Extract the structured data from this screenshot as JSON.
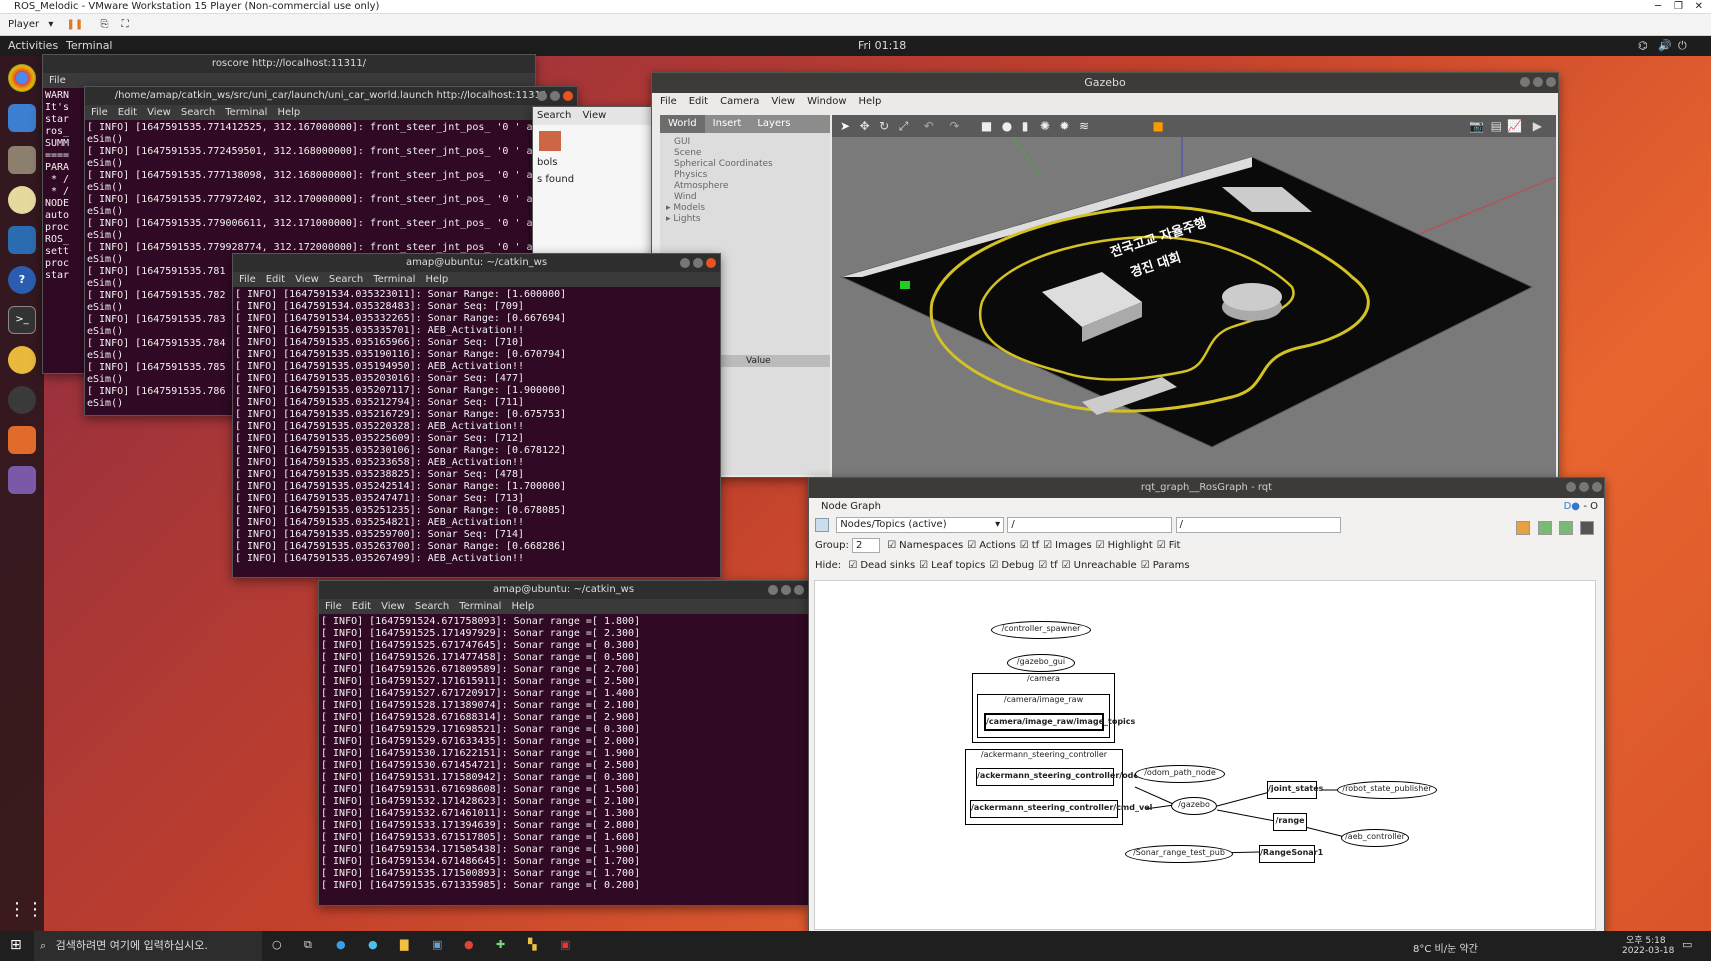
{
  "vm": {
    "title": "ROS_Melodic - VMware Workstation 15 Player (Non-commercial use only)",
    "player_label": "Player"
  },
  "topbar": {
    "activities": "Activities",
    "app_menu": "Terminal",
    "clock": "Fri 01:18"
  },
  "term_roscore": {
    "title": "roscore http://localhost:11311/",
    "menu_file": "File",
    "lines": [
      "WARN",
      "It's",
      "",
      "star",
      "ros_",
      "",
      "",
      "SUMM",
      "====",
      "",
      "PARA",
      " * /",
      " * /",
      "",
      "NODE",
      "",
      "auto",
      "proc",
      "ROS_",
      "",
      "sett",
      "proc",
      "star"
    ]
  },
  "term_launch": {
    "title": "/home/amap/catkin_ws/src/uni_car/launch/uni_car_world.launch http://localhost:11311",
    "menu": [
      "File",
      "Edit",
      "View",
      "Search",
      "Terminal",
      "Help"
    ],
    "lines": [
      "[ INFO] [1647591535.771412525, 312.167000000]: front_steer_jnt_pos_ '0 ' at writ",
      "eSim()",
      "[ INFO] [1647591535.772459501, 312.168000000]: front_steer_jnt_pos_ '0 ' at writ",
      "eSim()",
      "[ INFO] [1647591535.777138098, 312.168000000]: front_steer_jnt_pos_ '0 ' at writ",
      "eSim()",
      "[ INFO] [1647591535.777972402, 312.170000000]: front_steer_jnt_pos_ '0 ' at writ",
      "eSim()",
      "[ INFO] [1647591535.779006611, 312.171000000]: front_steer_jnt_pos_ '0 ' at writ",
      "eSim()",
      "[ INFO] [1647591535.779928774, 312.172000000]: front_steer_jnt_pos_ '0 ' at writ",
      "eSim()",
      "[ INFO] [1647591535.781",
      "eSim()",
      "[ INFO] [1647591535.782",
      "eSim()",
      "[ INFO] [1647591535.783",
      "eSim()",
      "[ INFO] [1647591535.784",
      "eSim()",
      "[ INFO] [1647591535.785",
      "eSim()",
      "[ INFO] [1647591535.786",
      "eSim()"
    ]
  },
  "term_sonar": {
    "title": "amap@ubuntu: ~/catkin_ws",
    "menu": [
      "File",
      "Edit",
      "View",
      "Search",
      "Terminal",
      "Help"
    ],
    "lines": [
      "[ INFO] [1647591534.035323011]: Sonar Range: [1.600000]",
      "[ INFO] [1647591534.035328483]: Sonar Seq: [709]",
      "[ INFO] [1647591534.035332265]: Sonar Range: [0.667694]",
      "[ INFO] [1647591535.035335701]: AEB_Activation!!",
      "[ INFO] [1647591535.035165966]: Sonar Seq: [710]",
      "[ INFO] [1647591535.035190116]: Sonar Range: [0.670794]",
      "[ INFO] [1647591535.035194950]: AEB_Activation!!",
      "[ INFO] [1647591535.035203016]: Sonar Seq: [477]",
      "[ INFO] [1647591535.035207117]: Sonar Range: [1.900000]",
      "[ INFO] [1647591535.035212794]: Sonar Seq: [711]",
      "[ INFO] [1647591535.035216729]: Sonar Range: [0.675753]",
      "[ INFO] [1647591535.035220328]: AEB_Activation!!",
      "[ INFO] [1647591535.035225609]: Sonar Seq: [712]",
      "[ INFO] [1647591535.035230106]: Sonar Range: [0.678122]",
      "[ INFO] [1647591535.035233658]: AEB_Activation!!",
      "[ INFO] [1647591535.035238825]: Sonar Seq: [478]",
      "[ INFO] [1647591535.035242514]: Sonar Range: [1.700000]",
      "[ INFO] [1647591535.035247471]: Sonar Seq: [713]",
      "[ INFO] [1647591535.035251235]: Sonar Range: [0.678085]",
      "[ INFO] [1647591535.035254821]: AEB_Activation!!",
      "[ INFO] [1647591535.035259700]: Sonar Seq: [714]",
      "[ INFO] [1647591535.035263700]: Sonar Range: [0.668286]",
      "[ INFO] [1647591535.035267499]: AEB_Activation!!"
    ]
  },
  "term_range": {
    "title": "amap@ubuntu: ~/catkin_ws",
    "menu": [
      "File",
      "Edit",
      "View",
      "Search",
      "Terminal",
      "Help"
    ],
    "lines": [
      "[ INFO] [1647591524.671758093]: Sonar range =[ 1.800]",
      "[ INFO] [1647591525.171497929]: Sonar range =[ 2.300]",
      "[ INFO] [1647591525.671747645]: Sonar range =[ 0.300]",
      "[ INFO] [1647591526.171477458]: Sonar range =[ 0.500]",
      "[ INFO] [1647591526.671809589]: Sonar range =[ 2.700]",
      "[ INFO] [1647591527.171615911]: Sonar range =[ 2.500]",
      "[ INFO] [1647591527.671720917]: Sonar range =[ 1.400]",
      "[ INFO] [1647591528.171389074]: Sonar range =[ 2.100]",
      "[ INFO] [1647591528.671688314]: Sonar range =[ 2.900]",
      "[ INFO] [1647591529.171698521]: Sonar range =[ 0.300]",
      "[ INFO] [1647591529.671633435]: Sonar range =[ 2.000]",
      "[ INFO] [1647591530.171622151]: Sonar range =[ 1.900]",
      "[ INFO] [1647591530.671454721]: Sonar range =[ 2.500]",
      "[ INFO] [1647591531.171580942]: Sonar range =[ 0.300]",
      "[ INFO] [1647591531.671698608]: Sonar range =[ 1.500]",
      "[ INFO] [1647591532.171428623]: Sonar range =[ 2.100]",
      "[ INFO] [1647591532.671461011]: Sonar range =[ 1.300]",
      "[ INFO] [1647591533.171394639]: Sonar range =[ 2.800]",
      "[ INFO] [1647591533.671517805]: Sonar range =[ 1.600]",
      "[ INFO] [1647591534.171505438]: Sonar range =[ 1.900]",
      "[ INFO] [1647591534.671486645]: Sonar range =[ 1.700]",
      "[ INFO] [1647591535.171500893]: Sonar range =[ 1.700]",
      "[ INFO] [1647591535.671335985]: Sonar range =[ 0.200]"
    ]
  },
  "gazebo": {
    "title": "Gazebo",
    "menu": [
      "File",
      "Edit",
      "Camera",
      "View",
      "Window",
      "Help"
    ],
    "tabs": [
      "World",
      "Insert",
      "Layers"
    ],
    "tree": [
      "GUI",
      "Scene",
      "Spherical Coordinates",
      "Physics",
      "Atmosphere",
      "Wind",
      "Models",
      "Lights"
    ],
    "value_header": "Value",
    "track_text_1": "전국고교 자율주행",
    "track_text_2": "경진 대회"
  },
  "bg_win": {
    "search": "Search",
    "view": "View",
    "tools": "bols",
    "found": "s found"
  },
  "rqt": {
    "title": "rqt_graph__RosGraph - rqt",
    "panel_title": "Node Graph",
    "mode_select": "Nodes/Topics (active)",
    "filter1": "/",
    "filter2": "/",
    "group_label": "Group:",
    "group_value": "2",
    "opts": [
      "Namespaces",
      "Actions",
      "tf",
      "Images",
      "Highlight",
      "Fit"
    ],
    "hide_label": "Hide:",
    "hide_opts": [
      "Dead sinks",
      "Leaf topics",
      "Debug",
      "tf",
      "Unreachable",
      "Params"
    ],
    "graph": {
      "controller_spawner": "/controller_spawner",
      "gazebo_gui": "/gazebo_gui",
      "camera_ns": "/camera",
      "camera_image_raw_ns": "/camera/image_raw",
      "camera_image_topics": "/camera/image_raw/image_topics",
      "ackermann_ns": "/ackermann_steering_controller",
      "odom_topic": "/ackermann_steering_controller/odom",
      "cmd_vel_topic": "/ackermann_steering_controller/cmd_vel",
      "odom_path_node": "/odom_path_node",
      "gazebo": "/gazebo",
      "joint_states": "/joint_states",
      "robot_state_publisher": "/robot_state_publisher",
      "range": "/range",
      "aeb_controller": "/aeb_controller",
      "sonar_range_test_pub": "/Sonar_range_test_pub",
      "range_sonar1": "/RangeSonar1"
    }
  },
  "taskbar": {
    "search_placeholder": "검색하려면 여기에 입력하십시오.",
    "weather": "8°C 비/눈 약간",
    "time": "오후 5:18",
    "date": "2022-03-18"
  }
}
